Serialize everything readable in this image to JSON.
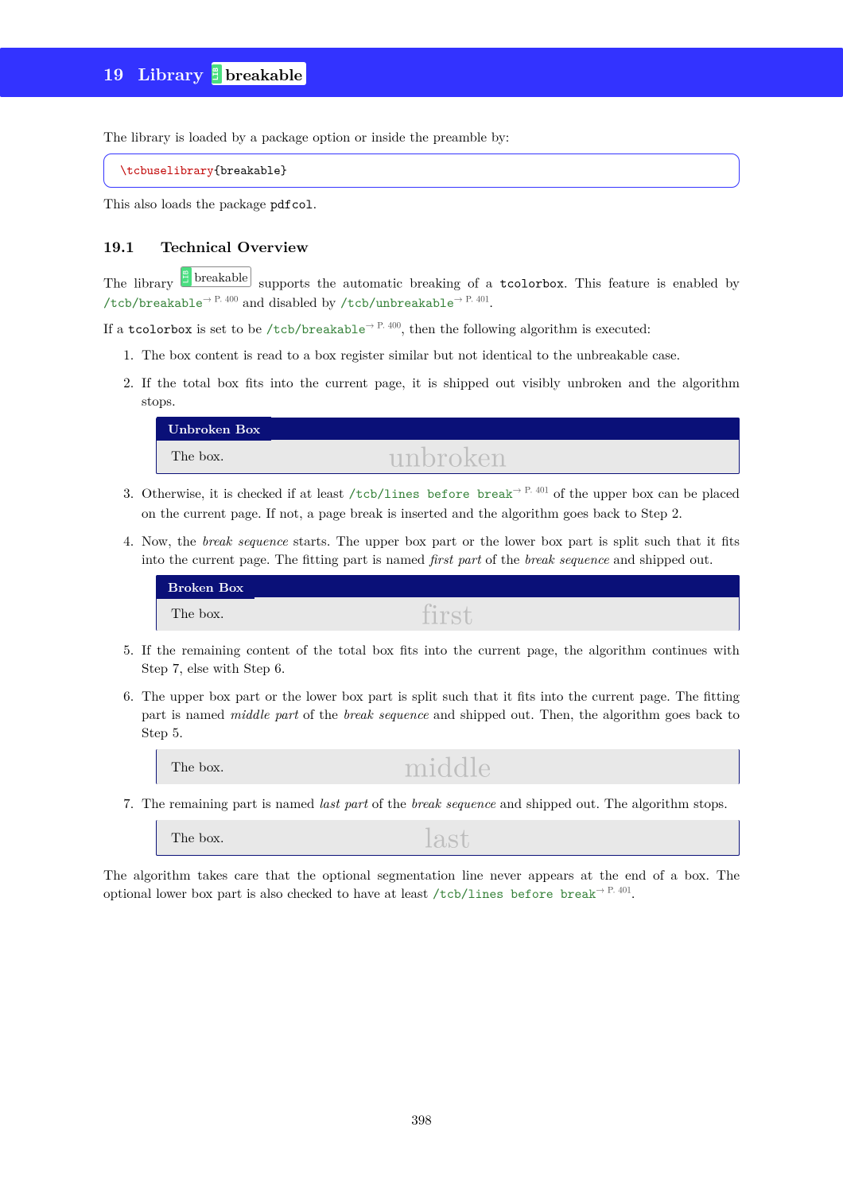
{
  "header": {
    "number": "19",
    "label": "Library",
    "lib_icon": "LIB",
    "lib_name": "breakable"
  },
  "intro": {
    "line1": "The library is loaded by a package option or inside the preamble by:",
    "code_cmd": "\\tcbuselibrary",
    "code_arg": "{breakable}",
    "line2_a": "This also loads the package ",
    "line2_pkg": "pdfcol",
    "line2_b": "."
  },
  "subsection": {
    "number": "19.1",
    "title": "Technical Overview"
  },
  "overview": {
    "p1_a": "The library ",
    "p1_lib": "breakable",
    "p1_b": " supports the automatic breaking of a ",
    "p1_tcb": "tcolorbox",
    "p1_c": ".  This feature is enabled by ",
    "p1_key1": "/tcb/breakable",
    "p1_ref1": "→ P. 400",
    "p1_d": " and disabled by ",
    "p1_key2": "/tcb/unbreakable",
    "p1_ref2": "→ P. 401",
    "p1_e": ".",
    "p2_a": "If a ",
    "p2_tcb": "tcolorbox",
    "p2_b": " is set to be ",
    "p2_key": "/tcb/breakable",
    "p2_ref": "→ P. 400",
    "p2_c": ", then the following algorithm is executed:"
  },
  "steps": {
    "s1": "The box content is read to a box register similar but not identical to the unbreakable case.",
    "s2": "If the total box fits into the current page, it is shipped out visibly unbroken and the algorithm stops.",
    "s3_a": "Otherwise, it is checked if at least ",
    "s3_key": "/tcb/lines before break",
    "s3_ref": "→ P. 401",
    "s3_b": " of the upper box can be placed on the current page. If not, a page break is inserted and the algorithm goes back to Step 2.",
    "s4_a": "Now, the ",
    "s4_em1": "break sequence",
    "s4_b": " starts. The upper box part or the lower box part is split such that it fits into the current page. The fitting part is named ",
    "s4_em2": "first part",
    "s4_c": " of the ",
    "s4_em3": "break sequence",
    "s4_d": " and shipped out.",
    "s5": "If the remaining content of the total box fits into the current page, the algorithm continues with Step 7, else with Step 6.",
    "s6_a": "The upper box part or the lower box part is split such that it fits into the current page. The fitting part is named ",
    "s6_em1": "middle part",
    "s6_b": " of the ",
    "s6_em2": "break sequence",
    "s6_c": " and shipped out. Then, the algorithm goes back to Step 5.",
    "s7_a": "The remaining part is named ",
    "s7_em1": "last part",
    "s7_b": " of the ",
    "s7_em2": "break sequence",
    "s7_c": " and shipped out. The algorithm stops."
  },
  "boxes": {
    "unbroken_title": "Unbroken Box",
    "broken_title": "Broken Box",
    "body_text": "The box.",
    "wm_unbroken": "unbroken",
    "wm_first": "first",
    "wm_middle": "middle",
    "wm_last": "last"
  },
  "footer_para": {
    "a": "The algorithm takes care that the optional segmentation line never appears at the end of a box. The optional lower box part is also checked to have at least ",
    "key": "/tcb/lines before break",
    "ref": "→ P. 401",
    "b": "."
  },
  "page_number": "398"
}
